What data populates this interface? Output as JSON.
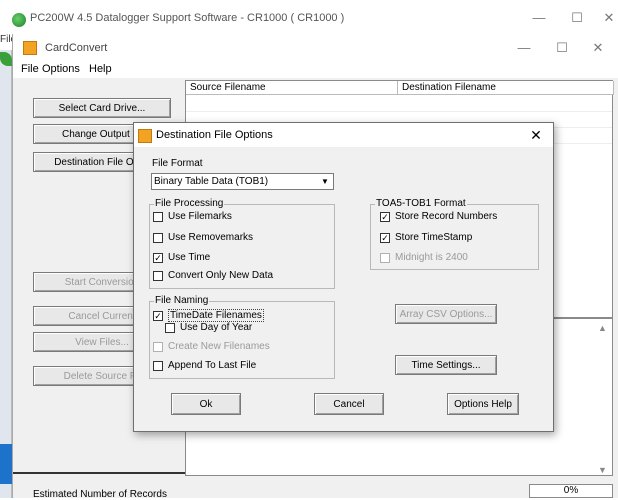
{
  "outer_window": {
    "title": "PC200W 4.5 Datalogger Support Software - CR1000 ( CR1000 )",
    "menu_stub": "File",
    "min_glyph": "—",
    "max_glyph": "☐",
    "close_glyph": "✕"
  },
  "cardconvert": {
    "title": "CardConvert",
    "min_glyph": "—",
    "max_glyph": "☐",
    "close_glyph": "✕",
    "menu": [
      "File",
      "Options",
      "Help"
    ],
    "buttons": {
      "select_card": "Select Card Drive...",
      "change_output": "Change Output Di",
      "dest_options": "Destination File Optio",
      "start": "Start Conversion",
      "cancel_current": "Cancel Current",
      "view_files": "View Files...",
      "delete_source": "Delete Source Fil"
    },
    "table": {
      "columns": [
        "Source Filename",
        "Destination Filename"
      ]
    },
    "log_scroll_up": "▲",
    "log_scroll_down": "▼",
    "status_label": "Estimated Number of Records",
    "progress_text": "0%"
  },
  "dialog": {
    "title": "Destination File Options",
    "close_glyph": "✕",
    "file_format_label": "File Format",
    "file_format_value": "Binary Table Data (TOB1)",
    "dropdown_arrow": "▼",
    "processing": {
      "title": "File Processing",
      "use_filemarks": "Use Filemarks",
      "use_removemarks": "Use Removemarks",
      "use_time": "Use Time",
      "convert_new": "Convert Only New Data"
    },
    "toa5": {
      "title": "TOA5-TOB1 Format",
      "store_record_numbers": "Store Record Numbers",
      "store_timestamp": "Store TimeStamp",
      "midnight_2400": "Midnight is 2400"
    },
    "naming": {
      "title": "File Naming",
      "timedate_filenames": "TimeDate Filenames",
      "use_day_of_year": "Use Day of Year",
      "create_new_filenames": "Create New Filenames",
      "append_last_file": "Append To Last File"
    },
    "checks": {
      "use_filemarks": false,
      "use_removemarks": false,
      "use_time": true,
      "convert_new": false,
      "store_record_numbers": true,
      "store_timestamp": true,
      "midnight_2400": false,
      "timedate_filenames": true,
      "use_day_of_year": false,
      "create_new_filenames": false,
      "append_last_file": false
    },
    "check_glyph": "✓",
    "buttons": {
      "array_csv": "Array CSV Options...",
      "time_settings": "Time Settings...",
      "ok": "Ok",
      "cancel": "Cancel",
      "options_help": "Options Help"
    }
  }
}
